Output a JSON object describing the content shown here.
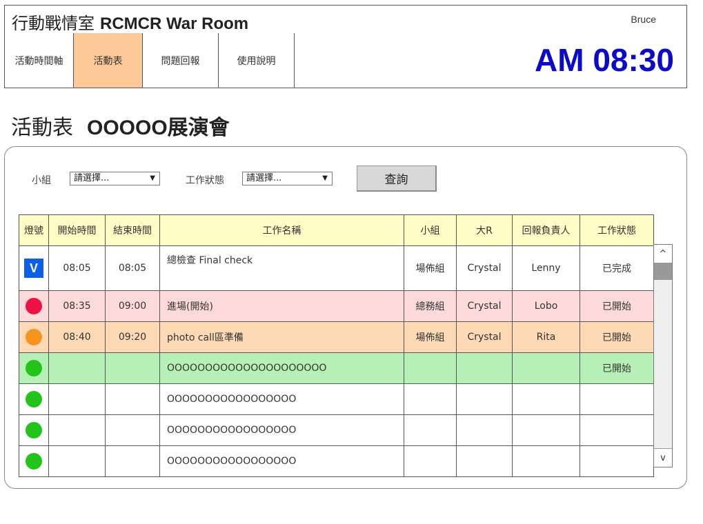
{
  "header": {
    "title_cn": "行動戰情室",
    "title_en": "RCMCR War Room",
    "user": "Bruce"
  },
  "nav": {
    "tabs": [
      {
        "label": "活動時間軸",
        "active": false
      },
      {
        "label": "活動表",
        "active": true
      },
      {
        "label": "問題回報",
        "active": false
      },
      {
        "label": "使用說明",
        "active": false
      }
    ],
    "clock": "AM 08:30"
  },
  "page": {
    "title": "活動表",
    "event": "OOOOO展演會"
  },
  "filters": {
    "group_label": "小組",
    "group_value": "請選擇...",
    "status_label": "工作狀態",
    "status_value": "請選擇...",
    "query_button": "查詢"
  },
  "table": {
    "headers": [
      "燈號",
      "開始時間",
      "結束時間",
      "工作名稱",
      "小組",
      "大R",
      "回報負責人",
      "工作狀態"
    ],
    "rows": [
      {
        "lamp": "V",
        "lamp_color": "#0b5fe8",
        "start": "08:05",
        "end": "08:05",
        "name": "總檢查 Final check",
        "group": "場佈組",
        "owner": "Crystal",
        "reporter": "Lenny",
        "status": "已完成"
      },
      {
        "lamp": "",
        "lamp_color": "#ee1144",
        "start": "08:35",
        "end": "09:00",
        "name": "進場(開始)",
        "group": "總務組",
        "owner": "Crystal",
        "reporter": "Lobo",
        "status": "已開始"
      },
      {
        "lamp": "",
        "lamp_color": "#f7941d",
        "start": "08:40",
        "end": "09:20",
        "name": "photo call區準備",
        "group": "場佈組",
        "owner": "Crystal",
        "reporter": "Rita",
        "status": "已開始"
      },
      {
        "lamp": "",
        "lamp_color": "#22c41a",
        "start": "",
        "end": "",
        "name": "OOOOOOOOOOOOOOOOOOOOO",
        "group": "",
        "owner": "",
        "reporter": "",
        "status": "已開始"
      },
      {
        "lamp": "",
        "lamp_color": "#22c41a",
        "start": "",
        "end": "",
        "name": "OOOOOOOOOOOOOOOOO",
        "group": "",
        "owner": "",
        "reporter": "",
        "status": ""
      },
      {
        "lamp": "",
        "lamp_color": "#22c41a",
        "start": "",
        "end": "",
        "name": "OOOOOOOOOOOOOOOOO",
        "group": "",
        "owner": "",
        "reporter": "",
        "status": ""
      },
      {
        "lamp": "",
        "lamp_color": "#22c41a",
        "start": "",
        "end": "",
        "name": "OOOOOOOOOOOOOOOOO",
        "group": "",
        "owner": "",
        "reporter": "",
        "status": ""
      }
    ]
  },
  "scrollbar": {
    "up": "^",
    "down": "v"
  },
  "colors": {
    "active_tab": "#fdc998",
    "clock": "#0a0ac8",
    "header_row": "#fffcc6",
    "row_pink": "#fcdada",
    "row_orange": "#fdd9b5",
    "row_green": "#b6f0b6"
  }
}
